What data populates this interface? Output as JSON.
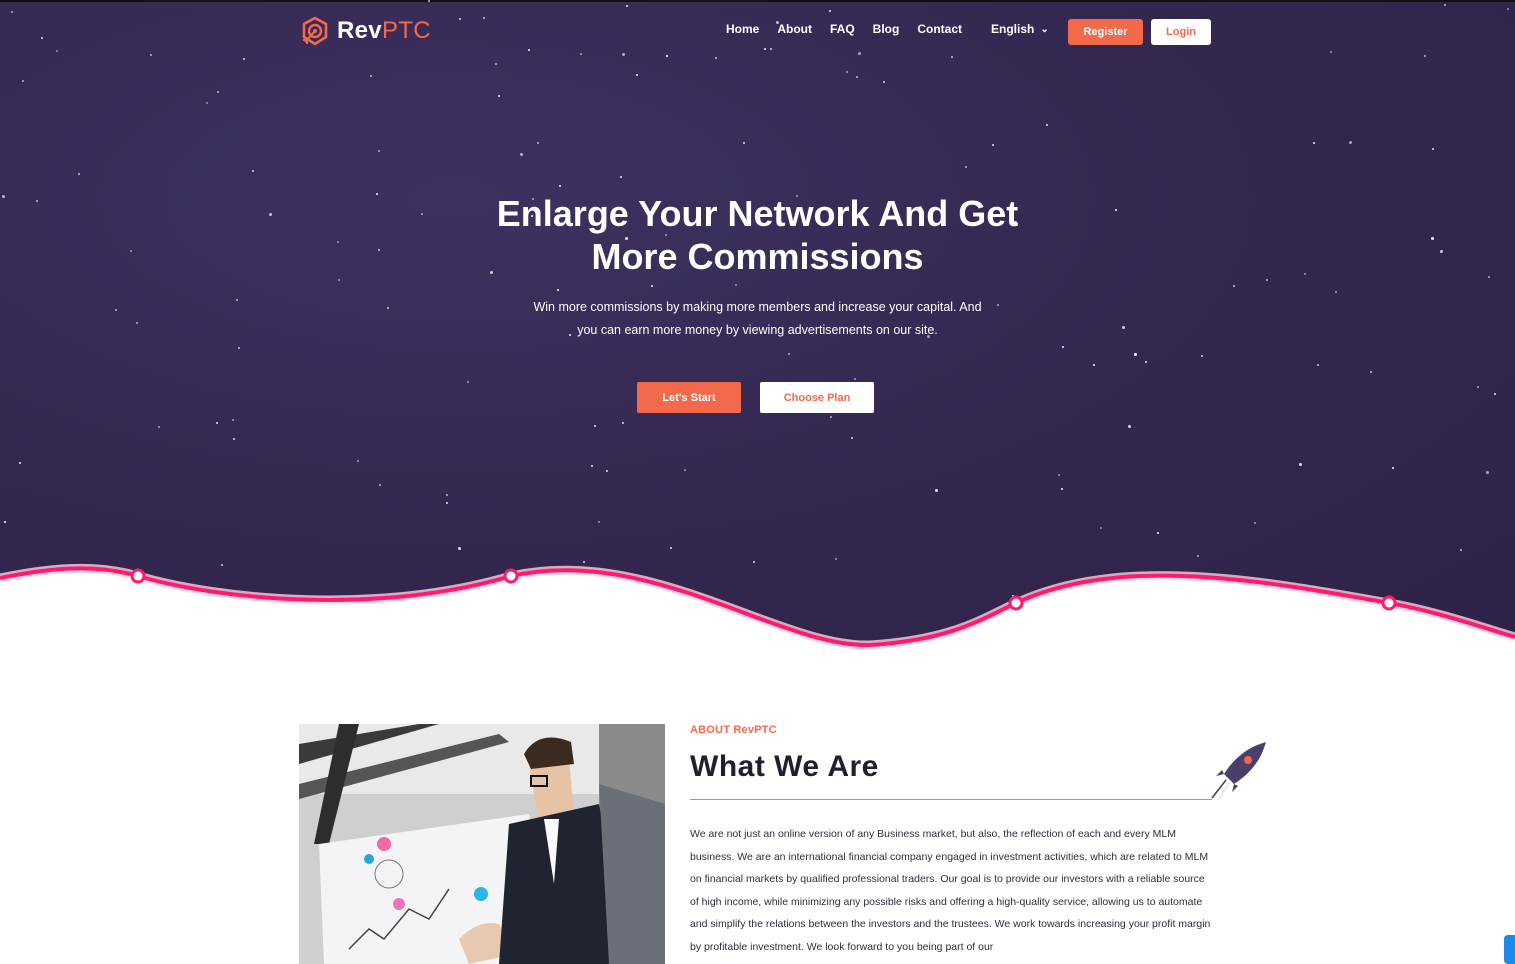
{
  "brand": {
    "name_main": "Rev",
    "name_accent": "PTC",
    "logo_icon": "target-arrow-icon",
    "accent_color": "#f26a4b",
    "hero_bg": "#33274f",
    "wave_color": "#ff1a6e"
  },
  "nav": {
    "items": [
      {
        "label": "Home"
      },
      {
        "label": "About"
      },
      {
        "label": "FAQ"
      },
      {
        "label": "Blog"
      },
      {
        "label": "Contact"
      }
    ],
    "language": "English",
    "language_icon": "chevron-down-icon",
    "register_label": "Register",
    "login_label": "Login"
  },
  "hero": {
    "title_line1": "Enlarge Your Network And Get",
    "title_line2": "More Commissions",
    "subtitle_line1": "Win more commissions by making more members and increase your capital. And",
    "subtitle_line2": "you can earn more money by viewing advertisements on our site.",
    "primary_cta": "Let's Start",
    "secondary_cta": "Choose Plan"
  },
  "about": {
    "eyebrow": "ABOUT RevPTC",
    "title": "What We Are",
    "decor_icon": "rocket-icon",
    "image_alt": "man-drawing-chart-on-whiteboard",
    "body": "We are not just an online version of any Business market, but also, the reflection of each and every MLM business. We are an international financial company engaged in investment activities, which are related to MLM on financial markets by qualified professional traders. Our goal is to provide our investors with a reliable source of high income, while minimizing any possible risks and offering a high-quality service, allowing us to automate and simplify the relations between the investors and the trustees. We work towards increasing your profit margin by profitable investment. We look forward to you being part of our"
  }
}
